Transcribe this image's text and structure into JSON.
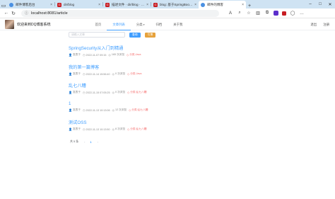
{
  "browser": {
    "tabs": [
      {
        "label": "邮件博客后台",
        "icon": "globe-icon",
        "active": false
      },
      {
        "label": "dir/blog",
        "icon": "gitee-icon",
        "active": false
      },
      {
        "label": "描述文件 · dir/blog · Gite",
        "icon": "gitee-icon",
        "active": false
      },
      {
        "label": "blog: 基于SpringBoot + Vu",
        "icon": "gitee-icon",
        "active": false
      },
      {
        "label": "邮件的博客",
        "icon": "globe-icon",
        "active": true
      }
    ],
    "url": "localhost:8081/article"
  },
  "header": {
    "site_title": "欢迎来到DQ博客系统",
    "nav": [
      {
        "label": "首页",
        "active": false
      },
      {
        "label": "文章列表",
        "active": true
      },
      {
        "label": "分类",
        "active": false,
        "caret": true
      },
      {
        "label": "归档",
        "active": false
      },
      {
        "label": "关于我",
        "active": false
      }
    ],
    "right": [
      "退出",
      "注册"
    ]
  },
  "search": {
    "placeholder": "请输入文章",
    "search_button": "查询",
    "write_button": "写博"
  },
  "articles": [
    {
      "title": "SpringSecurity从入门到精通",
      "author": "发表于",
      "date": "2022-11-07 09:15",
      "views": "165 次浏览",
      "category": "分类:Java"
    },
    {
      "title": "我的第一篇博客",
      "author": "发表于",
      "date": "2022-11-14 15:56:40",
      "views": "0 次浏览",
      "category": "分类:Java"
    },
    {
      "title": "乱七八糟",
      "author": "发表于",
      "date": "2022-11-15 07:05:25",
      "views": "0 次浏览",
      "category": "分类:乱七八糟"
    },
    {
      "title": "1",
      "author": "发表于",
      "date": "2022-11-13 10:13:06",
      "views": "12 次浏览",
      "category": "分类:乱七八糟"
    },
    {
      "title": "测试OSS",
      "author": "发表于",
      "date": "2022-11-13 10:13:50",
      "views": "8 次浏览",
      "category": "分类:乱七八糟"
    }
  ],
  "pagination": {
    "total": "共 5 条",
    "prev": "‹",
    "current": "1",
    "next": "›"
  }
}
